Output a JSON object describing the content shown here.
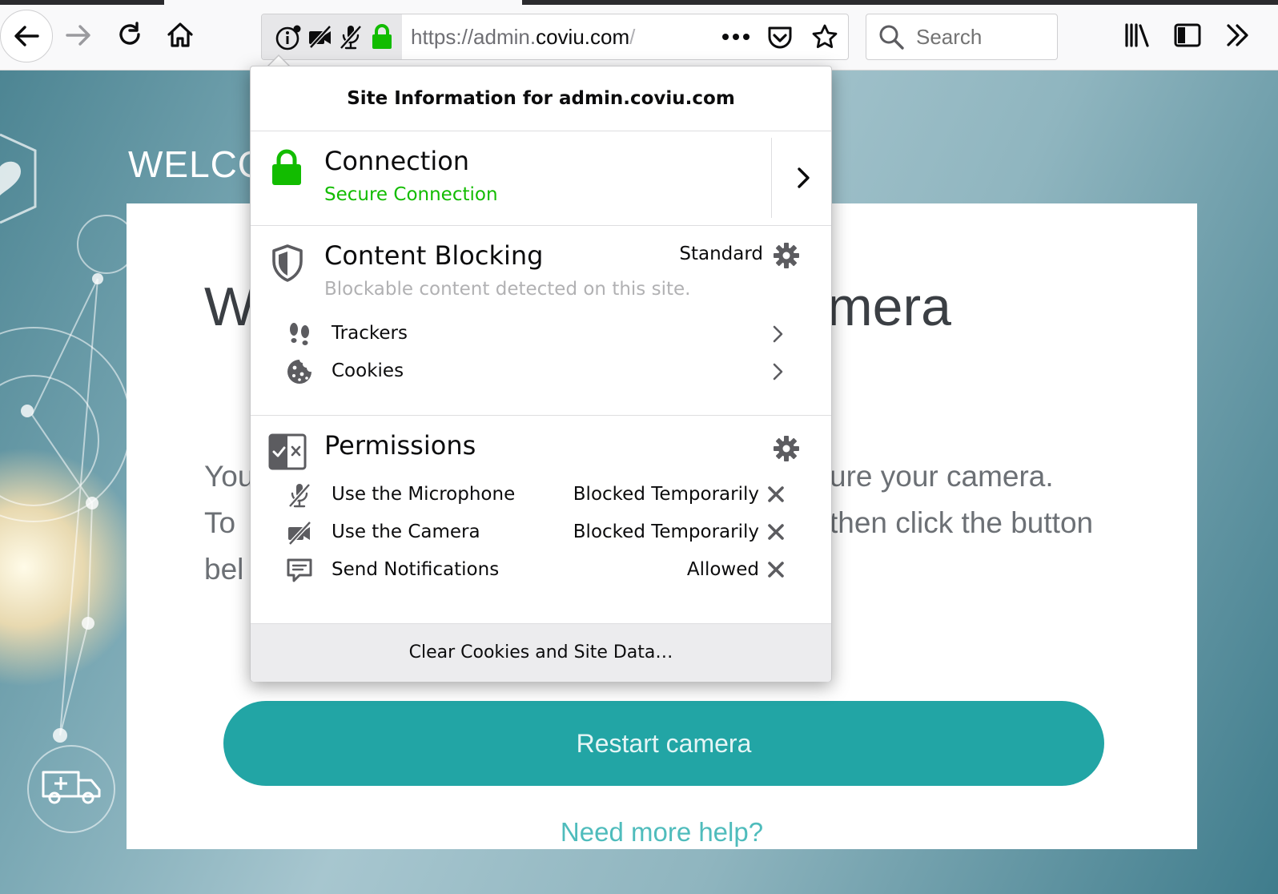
{
  "toolbar": {
    "url_scheme": "https://admin.",
    "url_host": "coviu.com",
    "url_path": "/",
    "search_placeholder": "Search"
  },
  "page": {
    "welcome_heading": "WELCO",
    "card_title_left": "W",
    "card_title_right": "mera",
    "line1_left": "You",
    "line1_right": "ure your camera.",
    "line2_left": "To",
    "line2_right": "then click the button",
    "line3_left": "bel",
    "button_label": "Restart camera",
    "help_link": "Need more help?"
  },
  "popup": {
    "header": "Site Information for admin.coviu.com",
    "connection": {
      "title": "Connection",
      "status": "Secure Connection",
      "status_color": "#12bc00"
    },
    "content_blocking": {
      "title": "Content Blocking",
      "mode": "Standard",
      "description": "Blockable content detected on this site.",
      "items": [
        {
          "label": "Trackers",
          "icon": "footprints-icon"
        },
        {
          "label": "Cookies",
          "icon": "cookie-icon"
        }
      ]
    },
    "permissions": {
      "title": "Permissions",
      "items": [
        {
          "label": "Use the Microphone",
          "state": "Blocked Temporarily",
          "icon": "microphone-blocked-icon"
        },
        {
          "label": "Use the Camera",
          "state": "Blocked Temporarily",
          "icon": "camera-blocked-icon"
        },
        {
          "label": "Send Notifications",
          "state": "Allowed",
          "icon": "notification-icon"
        }
      ]
    },
    "footer_button": "Clear Cookies and Site Data…"
  }
}
